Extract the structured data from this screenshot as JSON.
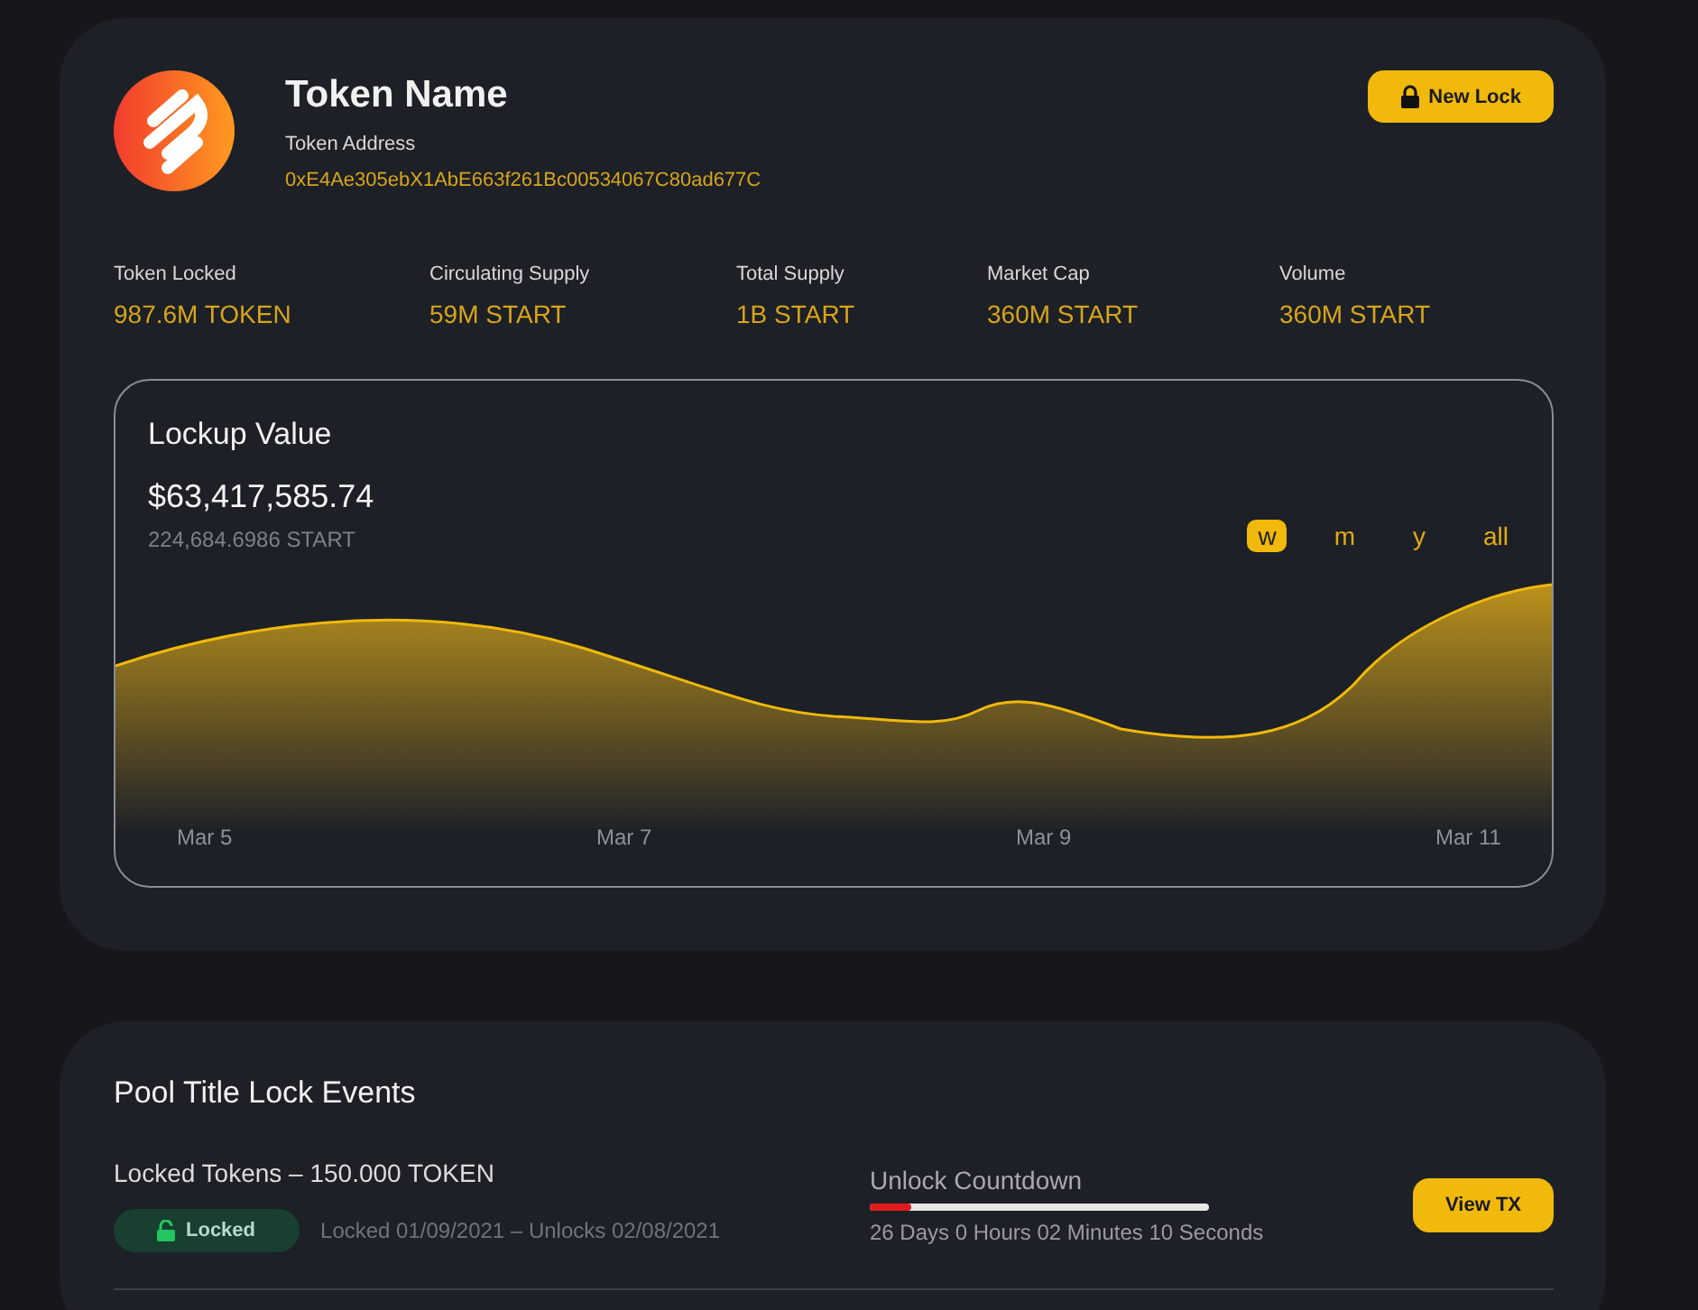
{
  "token": {
    "name": "Token Name",
    "address_label": "Token Address",
    "address": "0xE4Ae305ebX1AbE663f261Bc00534067C80ad677C",
    "new_lock_button": "New Lock"
  },
  "stats": [
    {
      "label": "Token Locked",
      "value": "987.6M TOKEN"
    },
    {
      "label": "Circulating Supply",
      "value": "59M START"
    },
    {
      "label": "Total Supply",
      "value": "1B START"
    },
    {
      "label": "Market Cap",
      "value": "360M START"
    },
    {
      "label": "Volume",
      "value": "360M START"
    }
  ],
  "lockup": {
    "title": "Lockup Value",
    "value": "$63,417,585.74",
    "sub_value": "224,684.6986 START",
    "ranges": [
      {
        "label": "w",
        "selected": true
      },
      {
        "label": "m",
        "selected": false
      },
      {
        "label": "y",
        "selected": false
      },
      {
        "label": "all",
        "selected": false
      }
    ],
    "x_labels": [
      "Mar 5",
      "Mar 7",
      "Mar 9",
      "Mar 11"
    ]
  },
  "events": {
    "title": "Pool Title Lock Events",
    "rows": [
      {
        "amount": "Locked Tokens – 150.000 TOKEN",
        "status": "Locked",
        "locked": true,
        "dates": "Locked 01/09/2021 – Unlocks 02/08/2021",
        "countdown_label": "Unlock Countdown",
        "level": 0.12,
        "countdown": "26 Days 0 Hours 02 Minutes 10 Seconds",
        "button": "View TX"
      }
    ]
  }
}
